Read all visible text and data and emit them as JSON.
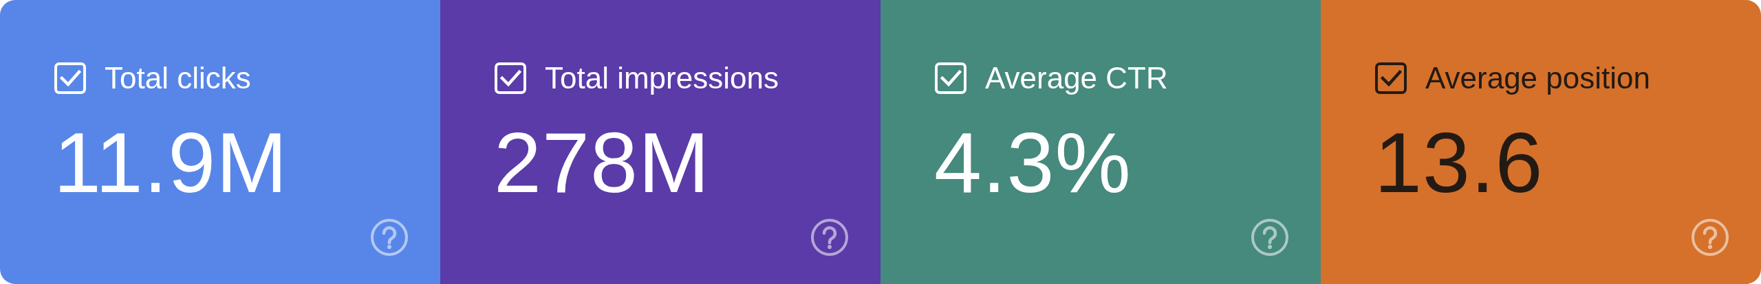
{
  "metrics": [
    {
      "label": "Total clicks",
      "value": "11.9M",
      "checked": true,
      "color": "#5886e8"
    },
    {
      "label": "Total impressions",
      "value": "278M",
      "checked": true,
      "color": "#5a3ba8"
    },
    {
      "label": "Average CTR",
      "value": "4.3%",
      "checked": true,
      "color": "#46897d"
    },
    {
      "label": "Average position",
      "value": "13.6",
      "checked": true,
      "color": "#d5712b"
    }
  ]
}
